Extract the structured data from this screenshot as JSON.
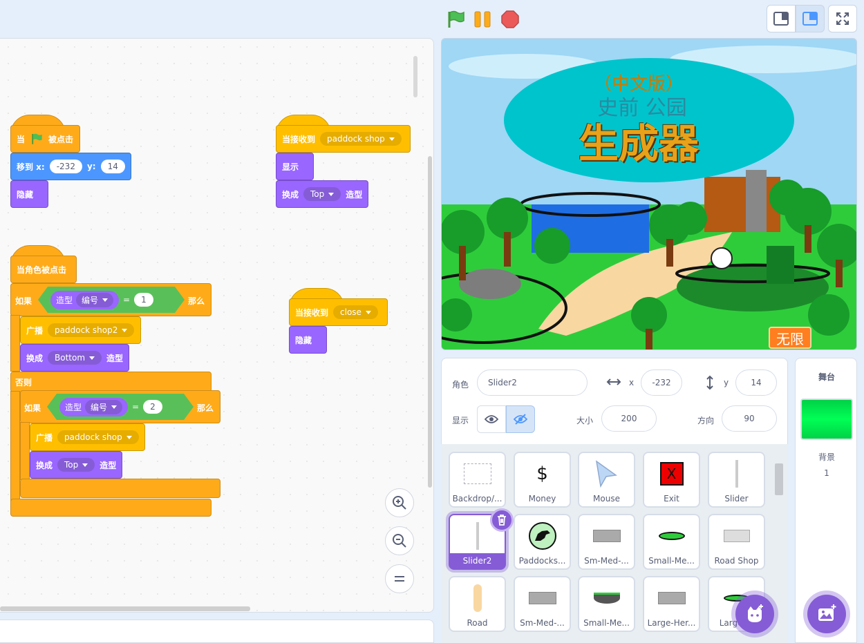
{
  "colors": {
    "flag": "#4cbf56",
    "pause": "#ffab19",
    "stop": "#ec5959",
    "stage_bg": "#00e64d",
    "accent": "#855cd6"
  },
  "icons": [
    "green-flag-icon",
    "pause-icon",
    "stop-icon",
    "small-stage-icon",
    "large-stage-icon",
    "fullscreen-icon",
    "zoom-in-icon",
    "zoom-out-icon",
    "zoom-reset-icon",
    "show-icon",
    "hide-icon",
    "delete-icon",
    "add-sprite-icon",
    "add-backdrop-icon"
  ],
  "code": {
    "script1": {
      "hat": "当",
      "hat_tail": "被点击",
      "goto_label": "移到 x:",
      "x": "-232",
      "y_label": "y:",
      "y": "14",
      "hide": "隐藏"
    },
    "script2": {
      "hat": "当接收到",
      "msg": "paddock shop",
      "show": "显示",
      "switch": "换成",
      "costume": "Top",
      "costume_tail": "造型"
    },
    "script3": {
      "hat": "当角色被点击",
      "if": "如果",
      "costume_rep": "造型",
      "rep_field": "编号",
      "eq": "=",
      "val1": "1",
      "then": "那么",
      "broadcast": "广播",
      "msg1": "paddock shop2",
      "switch": "换成",
      "costume1": "Bottom",
      "costume_tail": "造型",
      "else": "否则",
      "val2": "2",
      "msg2": "paddock shop",
      "costume2": "Top"
    },
    "script4": {
      "hat": "当接收到",
      "msg": "close",
      "hide": "隐藏"
    }
  },
  "stage": {
    "line1": "（中文版）",
    "line2": "史前  公园",
    "line3": "生成器",
    "badge": "无限"
  },
  "sprite_info": {
    "sprite_label": "角色",
    "sprite_name": "Slider2",
    "x_label": "x",
    "x": "-232",
    "y_label": "y",
    "y": "14",
    "show_label": "显示",
    "size_label": "大小",
    "size": "200",
    "direction_label": "方向",
    "direction": "90"
  },
  "sprites": [
    {
      "name": "Backdrop/...",
      "thumb": ""
    },
    {
      "name": "Money",
      "thumb": "$"
    },
    {
      "name": "Mouse",
      "thumb": ""
    },
    {
      "name": "Exit",
      "thumb": "X"
    },
    {
      "name": "Slider",
      "thumb": ""
    },
    {
      "name": "Slider2",
      "thumb": ""
    },
    {
      "name": "Paddocks...",
      "thumb": ""
    },
    {
      "name": "Sm-Med-...",
      "thumb": ""
    },
    {
      "name": "Small-Me...",
      "thumb": ""
    },
    {
      "name": "Road Shop",
      "thumb": ""
    },
    {
      "name": "Road",
      "thumb": ""
    },
    {
      "name": "Sm-Med-...",
      "thumb": ""
    },
    {
      "name": "Small-Me...",
      "thumb": ""
    },
    {
      "name": "Large-Her...",
      "thumb": ""
    },
    {
      "name": "Large-...",
      "thumb": ""
    }
  ],
  "stage_panel": {
    "title": "舞台",
    "backdrop_label": "背景",
    "backdrop_count": "1"
  }
}
